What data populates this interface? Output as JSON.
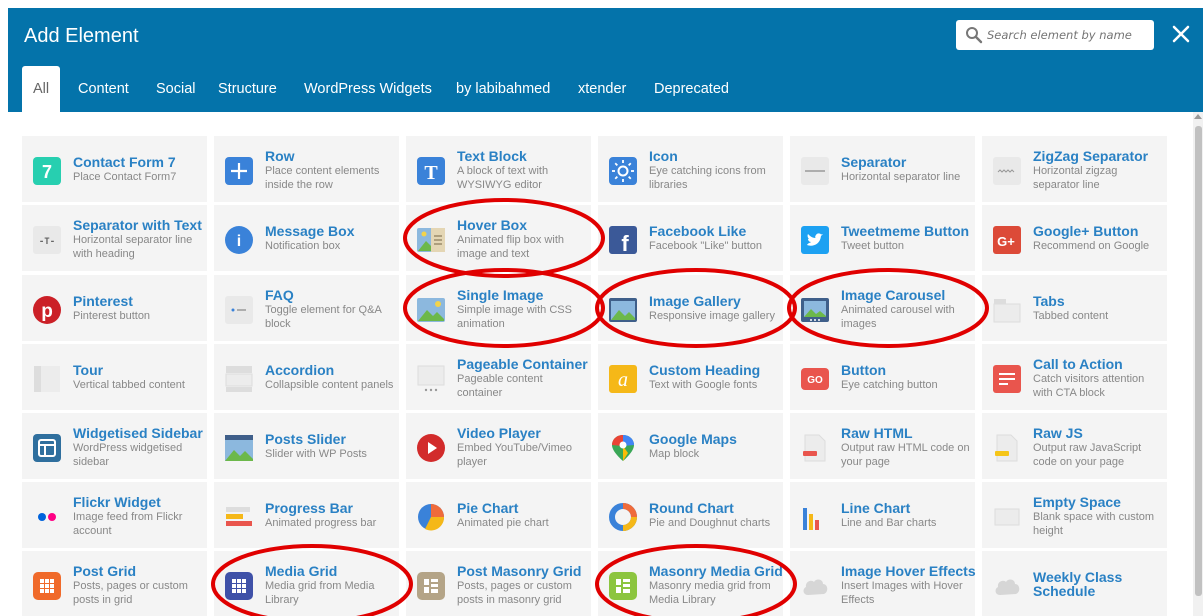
{
  "window": {
    "title": "Add Element"
  },
  "search": {
    "placeholder": "Search element by name"
  },
  "tabs": [
    "All",
    "Content",
    "Social",
    "Structure",
    "WordPress Widgets",
    "by labibahmed",
    "xtender",
    "Deprecated"
  ],
  "elements": [
    {
      "name": "Contact Form 7",
      "desc": "Place Contact Form7",
      "icon": "contact-form-7-icon",
      "color": "#27cfb0"
    },
    {
      "name": "Row",
      "desc": "Place content elements inside the row",
      "icon": "plus-icon",
      "color": "#3a82d9"
    },
    {
      "name": "Text Block",
      "desc": "A block of text with WYSIWYG editor",
      "icon": "text-block-icon",
      "color": "#3a82d9"
    },
    {
      "name": "Icon",
      "desc": "Eye catching icons from libraries",
      "icon": "sun-icon",
      "color": "#3a82d9"
    },
    {
      "name": "Separator",
      "desc": "Horizontal separator line",
      "icon": "separator-icon",
      "color": "#e9e9e9"
    },
    {
      "name": "ZigZag Separator",
      "desc": "Horizontal zigzag separator line",
      "icon": "zigzag-icon",
      "color": "#e9e9e9"
    },
    {
      "name": "Separator with Text",
      "desc": "Horizontal separator line with heading",
      "icon": "separator-text-icon",
      "color": "#e9e9e9"
    },
    {
      "name": "Message Box",
      "desc": "Notification box",
      "icon": "info-icon",
      "color": "#3a82d9"
    },
    {
      "name": "Hover Box",
      "desc": "Animated flip box with image and text",
      "icon": "hover-box-icon",
      "color": "#5b9dd7"
    },
    {
      "name": "Facebook Like",
      "desc": "Facebook \"Like\" button",
      "icon": "facebook-icon",
      "color": "#3b5998"
    },
    {
      "name": "Tweetmeme Button",
      "desc": "Tweet button",
      "icon": "twitter-icon",
      "color": "#1da1f2"
    },
    {
      "name": "Google+ Button",
      "desc": "Recommend on Google",
      "icon": "google-plus-icon",
      "color": "#dc4a38"
    },
    {
      "name": "Pinterest",
      "desc": "Pinterest button",
      "icon": "pinterest-icon",
      "color": "#cb2027"
    },
    {
      "name": "FAQ",
      "desc": "Toggle element for Q&A block",
      "icon": "faq-icon",
      "color": "#e9e9e9"
    },
    {
      "name": "Single Image",
      "desc": "Simple image with CSS animation",
      "icon": "image-icon",
      "color": "#5b9dd7"
    },
    {
      "name": "Image Gallery",
      "desc": "Responsive image gallery",
      "icon": "gallery-icon",
      "color": "#3f5f8a"
    },
    {
      "name": "Image Carousel",
      "desc": "Animated carousel with images",
      "icon": "carousel-icon",
      "color": "#3f5f8a"
    },
    {
      "name": "Tabs",
      "desc": "Tabbed content",
      "icon": "tabs-icon",
      "color": "#e9e9e9"
    },
    {
      "name": "Tour",
      "desc": "Vertical tabbed content",
      "icon": "tour-icon",
      "color": "#e9e9e9"
    },
    {
      "name": "Accordion",
      "desc": "Collapsible content panels",
      "icon": "accordion-icon",
      "color": "#e9e9e9"
    },
    {
      "name": "Pageable Container",
      "desc": "Pageable content container",
      "icon": "pageable-icon",
      "color": "#e9e9e9"
    },
    {
      "name": "Custom Heading",
      "desc": "Text with Google fonts",
      "icon": "heading-icon",
      "color": "#f5b818"
    },
    {
      "name": "Button",
      "desc": "Eye catching button",
      "icon": "button-icon",
      "color": "#e9554d"
    },
    {
      "name": "Call to Action",
      "desc": "Catch visitors attention with CTA block",
      "icon": "cta-icon",
      "color": "#e9554d"
    },
    {
      "name": "Widgetised Sidebar",
      "desc": "WordPress widgetised sidebar",
      "icon": "sidebar-icon",
      "color": "#2f6f9e"
    },
    {
      "name": "Posts Slider",
      "desc": "Slider with WP Posts",
      "icon": "posts-slider-icon",
      "color": "#5b9dd7"
    },
    {
      "name": "Video Player",
      "desc": "Embed YouTube/Vimeo player",
      "icon": "video-icon",
      "color": "#d22b2b"
    },
    {
      "name": "Google Maps",
      "desc": "Map block",
      "icon": "map-pin-icon",
      "color": "#3aa757"
    },
    {
      "name": "Raw HTML",
      "desc": "Output raw HTML code on your page",
      "icon": "raw-html-icon",
      "color": "#e9e9e9"
    },
    {
      "name": "Raw JS",
      "desc": "Output raw JavaScript code on your page",
      "icon": "raw-js-icon",
      "color": "#e9e9e9"
    },
    {
      "name": "Flickr Widget",
      "desc": "Image feed from Flickr account",
      "icon": "flickr-icon",
      "color": "#e9e9e9"
    },
    {
      "name": "Progress Bar",
      "desc": "Animated progress bar",
      "icon": "progress-bar-icon",
      "color": "#e9e9e9"
    },
    {
      "name": "Pie Chart",
      "desc": "Animated pie chart",
      "icon": "pie-chart-icon",
      "color": "#ef6b3b"
    },
    {
      "name": "Round Chart",
      "desc": "Pie and Doughnut charts",
      "icon": "round-chart-icon",
      "color": "#ef6b3b"
    },
    {
      "name": "Line Chart",
      "desc": "Line and Bar charts",
      "icon": "line-chart-icon",
      "color": "#3a82d9"
    },
    {
      "name": "Empty Space",
      "desc": "Blank space with custom height",
      "icon": "empty-space-icon",
      "color": "#e9e9e9"
    },
    {
      "name": "Post Grid",
      "desc": "Posts, pages or custom posts in grid",
      "icon": "post-grid-icon",
      "color": "#f06a2a"
    },
    {
      "name": "Media Grid",
      "desc": "Media grid from Media Library",
      "icon": "media-grid-icon",
      "color": "#3f51a8"
    },
    {
      "name": "Post Masonry Grid",
      "desc": "Posts, pages or custom posts in masonry grid",
      "icon": "masonry-grid-icon",
      "color": "#b4a487"
    },
    {
      "name": "Masonry Media Grid",
      "desc": "Masonry media grid from Media Library",
      "icon": "masonry-media-icon",
      "color": "#8cc53f"
    },
    {
      "name": "Image Hover Effects",
      "desc": "Insert Images with Hover Effects",
      "icon": "cloud-icon",
      "color": "#e0e0e0"
    },
    {
      "name": "Weekly Class Schedule",
      "desc": "",
      "icon": "cloud-icon",
      "color": "#e0e0e0"
    }
  ],
  "highlighted": [
    "Hover Box",
    "Single Image",
    "Image Gallery",
    "Image Carousel",
    "Media Grid",
    "Masonry Media Grid"
  ],
  "colors": {
    "header": "#0473aa",
    "link": "#2a81c4",
    "annotation": "#e00000"
  }
}
